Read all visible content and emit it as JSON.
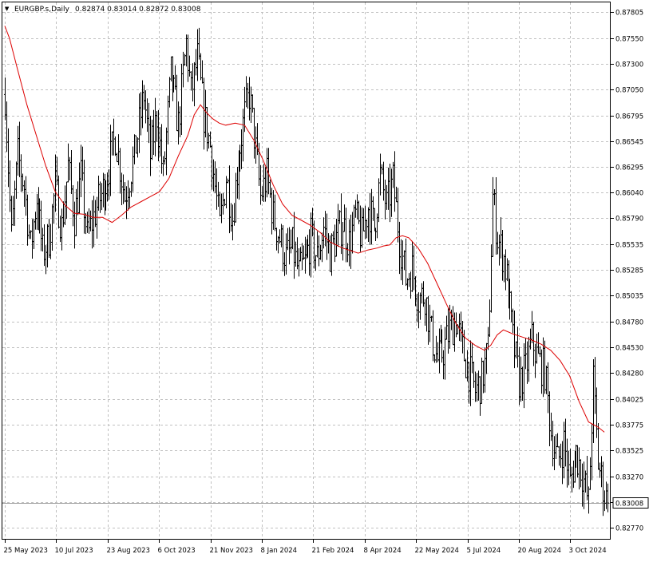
{
  "header": {
    "symbol_label": "EURGBP.s,Daily",
    "ohlc": "0.82874 0.83014 0.82872 0.83008",
    "collapse_glyph": "▼"
  },
  "colors": {
    "background": "#ffffff",
    "grid": "#c0c0c0",
    "bars": "#000000",
    "moving_average": "#dd0000",
    "current_price_line": "#a0a0a0"
  },
  "chart_data": {
    "type": "ohlc",
    "symbol": "EURGBP.s",
    "timeframe": "Daily",
    "current_price": 0.83008,
    "price_label": "0.83008",
    "ylim": [
      0.8265,
      0.879
    ],
    "grid": true,
    "y_ticks": [
      "0.87805",
      "0.87550",
      "0.87300",
      "0.87050",
      "0.86795",
      "0.86545",
      "0.86295",
      "0.86040",
      "0.85790",
      "0.85535",
      "0.85285",
      "0.85035",
      "0.84780",
      "0.84530",
      "0.84280",
      "0.84025",
      "0.83775",
      "0.83525",
      "0.83270",
      "0.83020",
      "0.82770"
    ],
    "x_ticks": [
      "25 May 2023",
      "10 Jul 2023",
      "23 Aug 2023",
      "6 Oct 2023",
      "21 Nov 2023",
      "8 Jan 2024",
      "21 Feb 2024",
      "8 Apr 2024",
      "22 May 2024",
      "5 Jul 2024",
      "20 Aug 2024",
      "3 Oct 2024"
    ],
    "close_path": [
      [
        0,
        0.87
      ],
      [
        4,
        0.856
      ],
      [
        8,
        0.864
      ],
      [
        12,
        0.861
      ],
      [
        16,
        0.855
      ],
      [
        20,
        0.86
      ],
      [
        24,
        0.8545
      ],
      [
        28,
        0.856
      ],
      [
        32,
        0.861
      ],
      [
        36,
        0.857
      ],
      [
        40,
        0.863
      ],
      [
        44,
        0.858
      ],
      [
        48,
        0.862
      ],
      [
        52,
        0.856
      ],
      [
        58,
        0.859
      ],
      [
        64,
        0.8615
      ],
      [
        70,
        0.866
      ],
      [
        76,
        0.86
      ],
      [
        82,
        0.864
      ],
      [
        88,
        0.87
      ],
      [
        92,
        0.864
      ],
      [
        96,
        0.868
      ],
      [
        100,
        0.862
      ],
      [
        105,
        0.872
      ],
      [
        110,
        0.867
      ],
      [
        115,
        0.875
      ],
      [
        118,
        0.87
      ],
      [
        122,
        0.8735
      ],
      [
        126,
        0.868
      ],
      [
        130,
        0.865
      ],
      [
        136,
        0.857
      ],
      [
        140,
        0.862
      ],
      [
        144,
        0.858
      ],
      [
        148,
        0.864
      ],
      [
        152,
        0.868
      ],
      [
        155,
        0.87
      ],
      [
        158,
        0.866
      ],
      [
        162,
        0.86
      ],
      [
        166,
        0.862
      ],
      [
        170,
        0.858
      ],
      [
        174,
        0.856
      ],
      [
        178,
        0.854
      ],
      [
        182,
        0.855
      ],
      [
        186,
        0.8525
      ],
      [
        190,
        0.8535
      ],
      [
        194,
        0.856
      ],
      [
        198,
        0.854
      ],
      [
        202,
        0.857
      ],
      [
        206,
        0.8545
      ],
      [
        210,
        0.856
      ],
      [
        214,
        0.8575
      ],
      [
        218,
        0.8555
      ],
      [
        222,
        0.858
      ],
      [
        226,
        0.856
      ],
      [
        230,
        0.859
      ],
      [
        234,
        0.857
      ],
      [
        238,
        0.862
      ],
      [
        242,
        0.859
      ],
      [
        246,
        0.8615
      ],
      [
        250,
        0.856
      ],
      [
        254,
        0.852
      ],
      [
        258,
        0.853
      ],
      [
        262,
        0.85
      ],
      [
        266,
        0.8505
      ],
      [
        270,
        0.8465
      ],
      [
        274,
        0.844
      ],
      [
        278,
        0.845
      ],
      [
        282,
        0.847
      ],
      [
        286,
        0.848
      ],
      [
        290,
        0.845
      ],
      [
        294,
        0.843
      ],
      [
        298,
        0.841
      ],
      [
        302,
        0.842
      ],
      [
        306,
        0.845
      ],
      [
        309,
        0.86
      ],
      [
        312,
        0.856
      ],
      [
        316,
        0.854
      ],
      [
        318,
        0.852
      ],
      [
        322,
        0.846
      ],
      [
        326,
        0.842
      ],
      [
        330,
        0.843
      ],
      [
        334,
        0.846
      ],
      [
        338,
        0.844
      ],
      [
        342,
        0.843
      ],
      [
        346,
        0.837
      ],
      [
        350,
        0.834
      ],
      [
        354,
        0.836
      ],
      [
        358,
        0.832
      ],
      [
        362,
        0.835
      ],
      [
        366,
        0.833
      ],
      [
        370,
        0.83
      ],
      [
        373,
        0.842
      ],
      [
        376,
        0.834
      ],
      [
        380,
        0.831
      ],
      [
        382,
        0.8301
      ]
    ],
    "moving_average": [
      [
        0,
        0.8767
      ],
      [
        3,
        0.8755
      ],
      [
        8,
        0.8725
      ],
      [
        14,
        0.869
      ],
      [
        20,
        0.866
      ],
      [
        26,
        0.863
      ],
      [
        32,
        0.8605
      ],
      [
        38,
        0.8592
      ],
      [
        44,
        0.8584
      ],
      [
        50,
        0.8583
      ],
      [
        56,
        0.858
      ],
      [
        62,
        0.858
      ],
      [
        68,
        0.8575
      ],
      [
        74,
        0.8582
      ],
      [
        80,
        0.859
      ],
      [
        86,
        0.8595
      ],
      [
        92,
        0.86
      ],
      [
        98,
        0.8605
      ],
      [
        104,
        0.8618
      ],
      [
        110,
        0.864
      ],
      [
        116,
        0.866
      ],
      [
        120,
        0.868
      ],
      [
        124,
        0.869
      ],
      [
        128,
        0.8682
      ],
      [
        132,
        0.8676
      ],
      [
        136,
        0.8672
      ],
      [
        140,
        0.867
      ],
      [
        146,
        0.8672
      ],
      [
        152,
        0.867
      ],
      [
        158,
        0.8655
      ],
      [
        164,
        0.8635
      ],
      [
        170,
        0.8612
      ],
      [
        176,
        0.8593
      ],
      [
        182,
        0.8582
      ],
      [
        188,
        0.8577
      ],
      [
        194,
        0.8572
      ],
      [
        200,
        0.8565
      ],
      [
        206,
        0.8556
      ],
      [
        210,
        0.8553
      ],
      [
        214,
        0.855
      ],
      [
        218,
        0.8548
      ],
      [
        224,
        0.8545
      ],
      [
        230,
        0.8548
      ],
      [
        236,
        0.855
      ],
      [
        240,
        0.8552
      ],
      [
        244,
        0.8553
      ],
      [
        248,
        0.856
      ],
      [
        252,
        0.8562
      ],
      [
        256,
        0.856
      ],
      [
        262,
        0.855
      ],
      [
        268,
        0.8535
      ],
      [
        274,
        0.8515
      ],
      [
        280,
        0.8495
      ],
      [
        286,
        0.8476
      ],
      [
        292,
        0.8462
      ],
      [
        298,
        0.8455
      ],
      [
        304,
        0.845
      ],
      [
        308,
        0.8455
      ],
      [
        312,
        0.8465
      ],
      [
        316,
        0.847
      ],
      [
        322,
        0.8466
      ],
      [
        328,
        0.8463
      ],
      [
        334,
        0.846
      ],
      [
        340,
        0.8456
      ],
      [
        346,
        0.845
      ],
      [
        352,
        0.844
      ],
      [
        358,
        0.8425
      ],
      [
        364,
        0.84
      ],
      [
        370,
        0.838
      ],
      [
        376,
        0.8375
      ],
      [
        380,
        0.837
      ]
    ]
  }
}
